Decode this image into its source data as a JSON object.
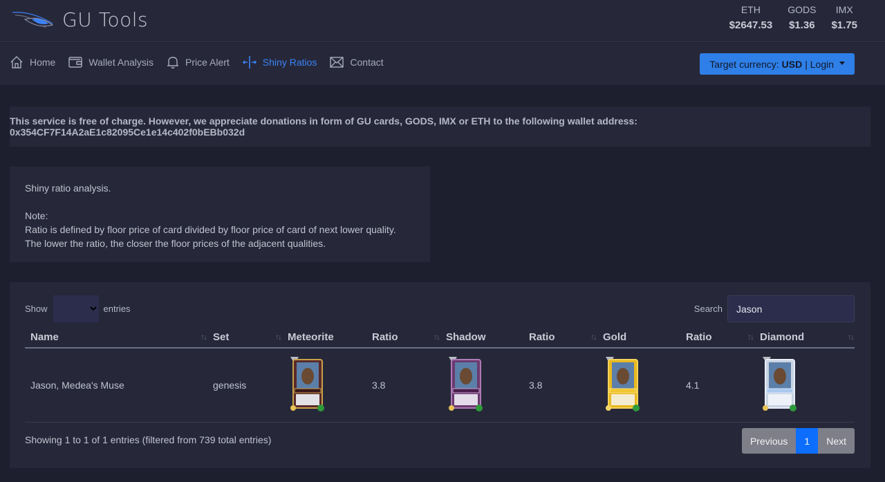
{
  "header": {
    "logo_text": "GU Tools",
    "prices": [
      {
        "symbol": "ETH",
        "value": "$2647.53"
      },
      {
        "symbol": "GODS",
        "value": "$1.36"
      },
      {
        "symbol": "IMX",
        "value": "$1.75"
      }
    ]
  },
  "nav": {
    "items": [
      {
        "label": "Home",
        "icon": "home-icon",
        "active": false
      },
      {
        "label": "Wallet Analysis",
        "icon": "wallet-icon",
        "active": false
      },
      {
        "label": "Price Alert",
        "icon": "bell-icon",
        "active": false
      },
      {
        "label": "Shiny Ratios",
        "icon": "arrows-split-icon",
        "active": true
      },
      {
        "label": "Contact",
        "icon": "envelope-icon",
        "active": false
      }
    ],
    "currency_button": {
      "prefix": "Target currency:",
      "currency": "USD",
      "suffix": "| Login"
    }
  },
  "colors": {
    "accent": "#2f7fe8",
    "active_nav": "#3b82f6",
    "page_current": "#0d6efd"
  },
  "donation": {
    "text": "This service is free of charge. However, we appreciate donations in form of GU cards, GODS, IMX or ETH to the following wallet address: 0x354CF7F14A2aE1c82095Ce1e14c402f0bEBb032d"
  },
  "info": {
    "title": "Shiny ratio analysis.",
    "note_label": "Note:",
    "note_text": "Ratio is defined by floor price of card divided by floor price of card of next lower quality. The lower the ratio, the closer the floor prices of the adjacent qualities."
  },
  "table": {
    "show_label": "Show",
    "entries_label": "entries",
    "search_label": "Search",
    "search_value": "Jason",
    "columns": [
      "Name",
      "Set",
      "Meteorite",
      "Ratio",
      "Shadow",
      "Ratio",
      "Gold",
      "Ratio",
      "Diamond"
    ],
    "sort_icon": "↑↓",
    "rows": [
      {
        "name": "Jason, Medea's Muse",
        "set": "genesis",
        "meteorite": "meteorite-card-image",
        "ratio_shadow": "3.8",
        "shadow": "shadow-card-image",
        "ratio_gold": "3.8",
        "gold": "gold-card-image",
        "ratio_diamond": "4.1",
        "diamond": "diamond-card-image"
      }
    ],
    "info_text": "Showing 1 to 1 of 1 entries (filtered from 739 total entries)",
    "pagination": {
      "previous": "Previous",
      "current": "1",
      "next": "Next"
    }
  }
}
